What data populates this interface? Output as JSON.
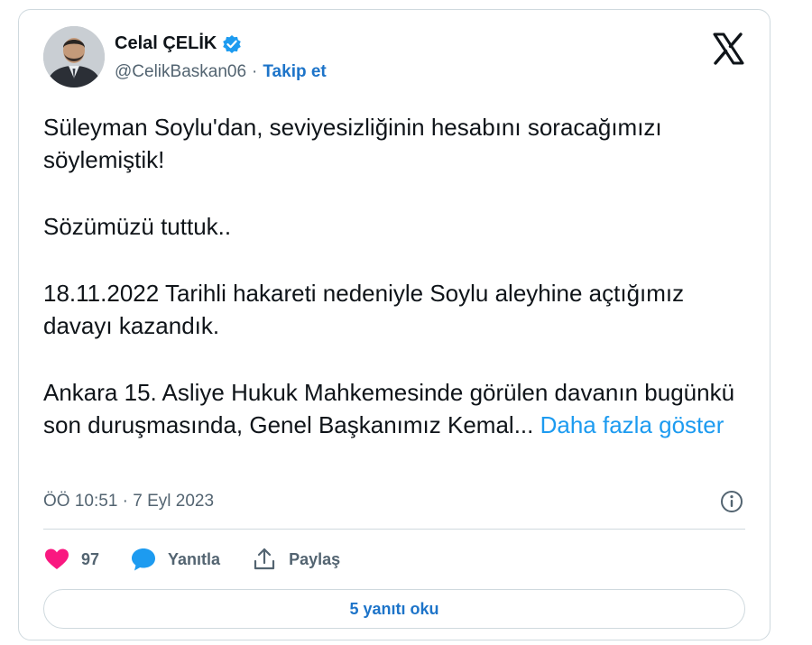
{
  "author": {
    "display_name": "Celal ÇELİK",
    "handle": "@CelikBaskan06",
    "separator": "·",
    "follow_label": "Takip et",
    "verified": true
  },
  "tweet": {
    "paragraphs": [
      "Süleyman Soylu'dan, seviyesizliğinin hesabını soracağımızı söylemiştik!",
      "Sözümüzü tuttuk..",
      "18.11.2022 Tarihli hakareti nedeniyle Soylu aleyhine açtığımız davayı kazandık."
    ],
    "last_paragraph": "Ankara 15. Asliye Hukuk Mahkemesinde görülen davanın bugünkü son duruşmasında, Genel Başkanımız Kemal...",
    "show_more_label": "Daha fazla göster",
    "timestamp": "ÖÖ 10:51 · 7 Eyl 2023"
  },
  "actions": {
    "like_count": "97",
    "reply_label": "Yanıtla",
    "share_label": "Paylaş"
  },
  "replies_button_label": "5 yanıtı oku",
  "colors": {
    "link_blue": "#1d74c9",
    "show_more_blue": "#1d9bf0",
    "like_pink": "#f91880",
    "reply_blue": "#1d9bf0",
    "muted_gray": "#536471",
    "border": "#cfd9de"
  },
  "icons": {
    "verified": "verified-badge-icon",
    "platform": "x-logo-icon",
    "info": "info-icon",
    "like": "heart-icon",
    "reply": "speech-bubble-icon",
    "share": "share-upload-icon"
  }
}
